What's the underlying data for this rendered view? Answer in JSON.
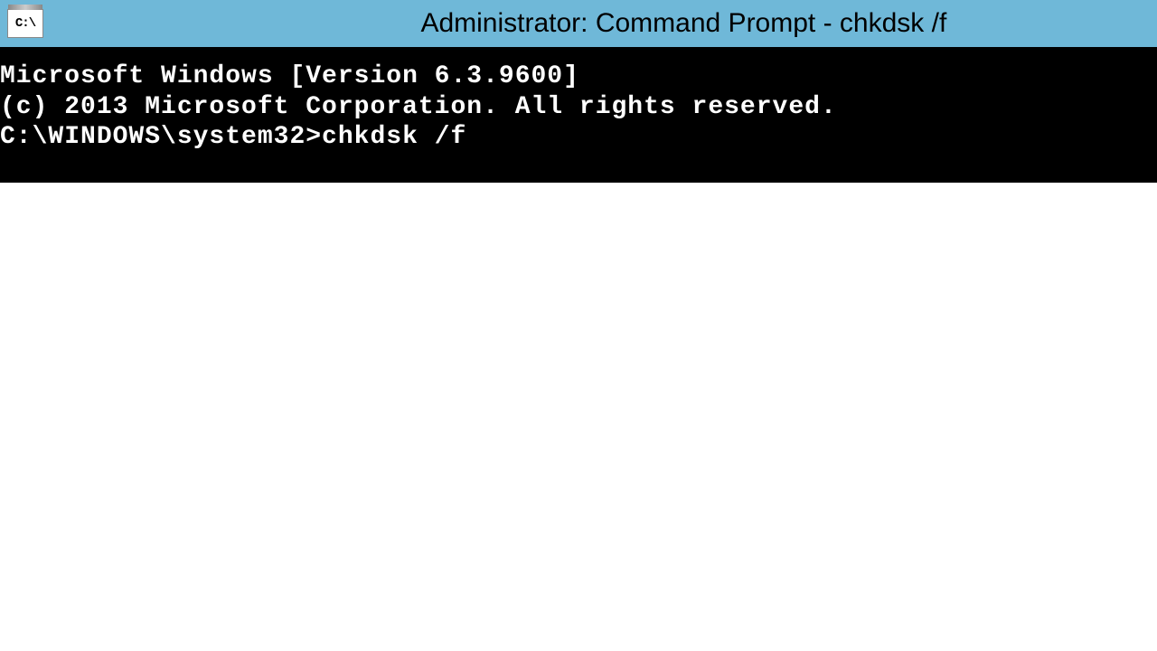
{
  "titlebar": {
    "icon_label": "C:\\",
    "title": "Administrator: Command Prompt - chkdsk  /f"
  },
  "terminal": {
    "lines": [
      "Microsoft Windows [Version 6.3.9600]",
      "(c) 2013 Microsoft Corporation. All rights reserved.",
      "",
      "C:\\WINDOWS\\system32>chkdsk /f"
    ]
  }
}
